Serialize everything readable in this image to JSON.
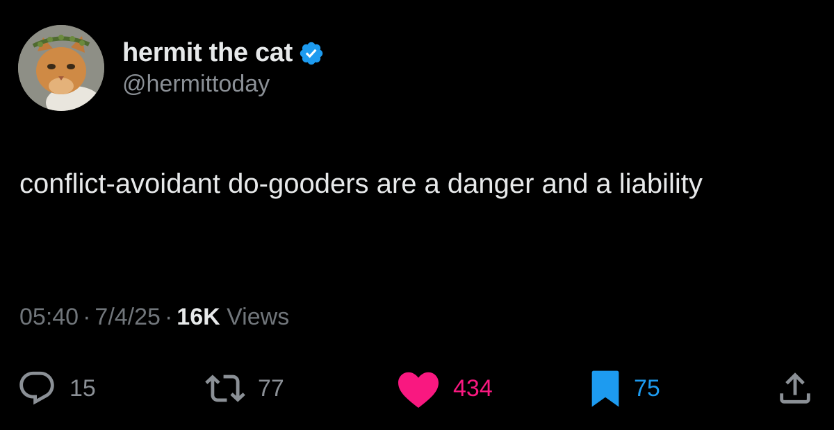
{
  "author": {
    "display_name": "hermit the cat",
    "handle": "@hermittoday",
    "verified": true,
    "avatar": "orange-cat-with-laurel-wreath"
  },
  "tweet": {
    "text": "conflict-avoidant do-gooders are a danger and a liability"
  },
  "meta": {
    "time": "05:40",
    "date": "7/4/25",
    "separator": "·",
    "views_count": "16K",
    "views_label": "Views"
  },
  "actions": {
    "reply": {
      "icon": "reply-icon",
      "count": "15"
    },
    "repost": {
      "icon": "repost-icon",
      "count": "77"
    },
    "like": {
      "icon": "heart-icon",
      "count": "434",
      "color": "#f91880"
    },
    "bookmark": {
      "icon": "bookmark-icon",
      "count": "75",
      "color": "#1d9bf0"
    },
    "share": {
      "icon": "share-icon"
    }
  },
  "colors": {
    "background": "#000000",
    "text": "#e7e9ea",
    "secondary": "#71767b",
    "verified": "#1d9bf0",
    "like": "#f91880",
    "bookmark": "#1d9bf0"
  }
}
